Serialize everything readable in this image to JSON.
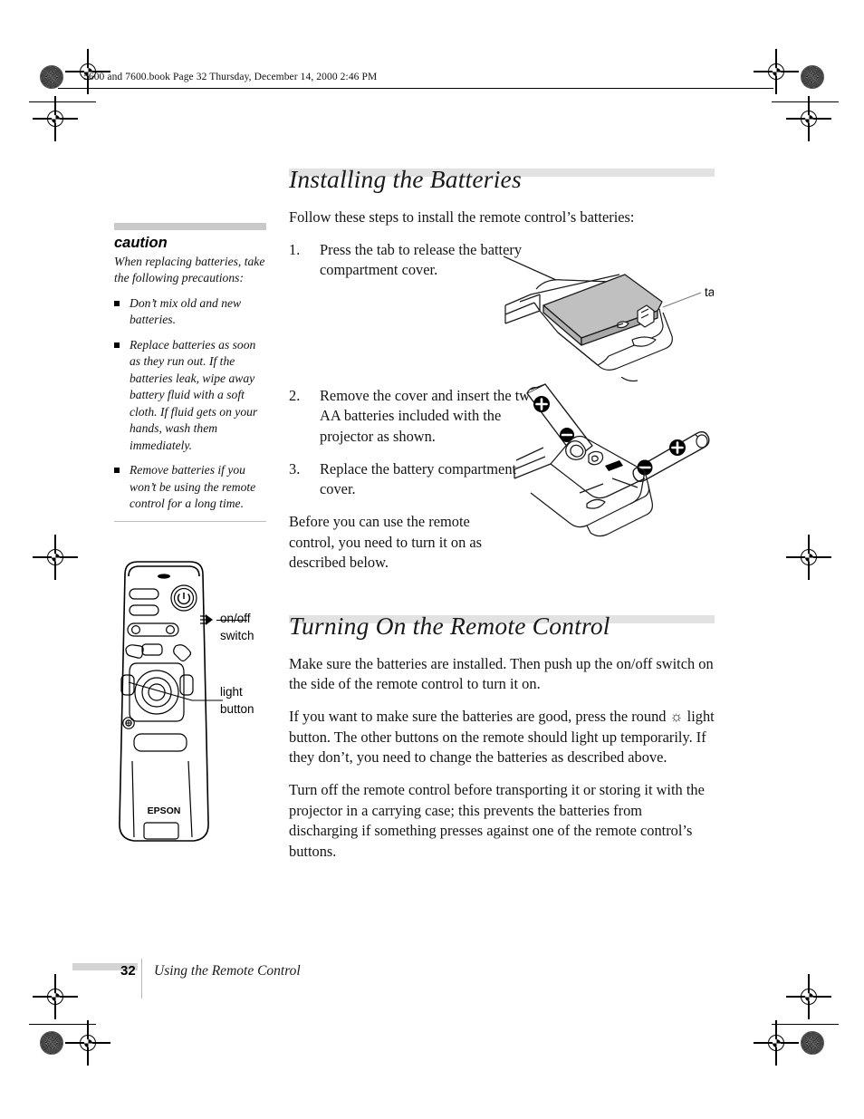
{
  "header": {
    "slug": "5600 and 7600.book  Page 32  Thursday, December 14, 2000  2:46 PM"
  },
  "caution": {
    "title": "caution",
    "intro": "When replacing batteries, take the following precautions:",
    "bullets": [
      "Don’t mix old and new batteries.",
      "Replace batteries as soon as they run out. If the batteries leak, wipe away battery fluid with a soft cloth. If fluid gets on your hands, wash them immediately.",
      "Remove batteries if you won’t be using the remote control for a long time."
    ]
  },
  "main": {
    "heading1": "Installing the Batteries",
    "intro": "Follow these steps to install the remote control’s batteries:",
    "steps": [
      {
        "num": "1.",
        "text": "Press the tab to release the battery compartment cover."
      },
      {
        "num": "2.",
        "text": "Remove the cover and insert the two AA batteries included with the projector as shown."
      },
      {
        "num": "3.",
        "text": "Replace the battery compartment cover."
      }
    ],
    "after_steps": "Before you can use the remote control, you need to turn it on as described below.",
    "heading2": "Turning On the Remote Control",
    "paragraphs": [
      "Make sure the batteries are installed. Then push up the on/off switch on the side of the remote control to turn it on.",
      "If you want to make sure the batteries are good, press the round ☼ light button. The other buttons on the remote should light up temporarily. If they don’t, you need to change the batteries as described above.",
      "Turn off the remote control before transporting it or storing it with the projector in a carrying case; this prevents the batteries from discharging if something presses against one of the remote control’s buttons."
    ]
  },
  "figures": {
    "tab_label": "tab",
    "onoff_label_line1": "on/off",
    "onoff_label_line2": "switch",
    "light_label_line1": "light",
    "light_label_line2": "button",
    "remote_brand": "EPSON"
  },
  "footer": {
    "page_number": "32",
    "chapter": "Using the Remote Control"
  },
  "colors": {
    "heading_bar": "#e2e2e2",
    "caution_bar": "#c9c9c9",
    "footer_bar": "#d4d4d4",
    "cover_fill": "#c0c0c0"
  }
}
